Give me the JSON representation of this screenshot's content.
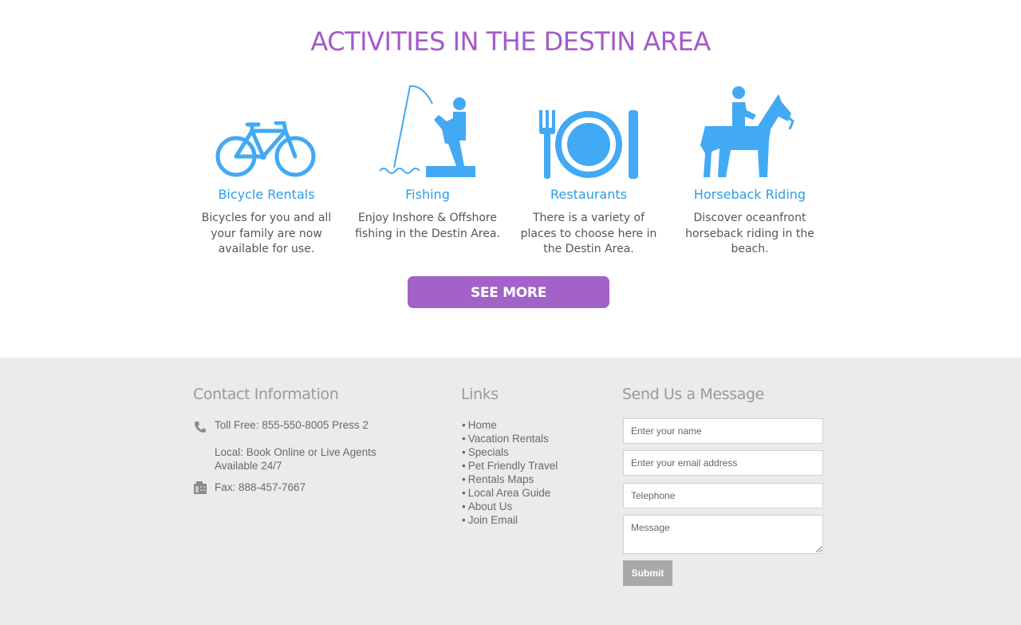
{
  "activities_section": {
    "title": "ACTIVITIES IN THE DESTIN AREA",
    "accent_color": "#a45ac8",
    "icon_color": "#42a9f5",
    "items": [
      {
        "icon": "bicycle-icon",
        "title": "Bicycle Rentals",
        "description": "Bicycles for you and all your family are now available for use."
      },
      {
        "icon": "fishing-icon",
        "title": "Fishing",
        "description": "Enjoy Inshore & Offshore fishing in the Destin Area."
      },
      {
        "icon": "restaurant-icon",
        "title": "Restaurants",
        "description": "There is a variety of places to choose here in the Destin Area."
      },
      {
        "icon": "horseback-icon",
        "title": "Horseback Riding",
        "description": "Discover oceanfront horseback riding in the beach."
      }
    ],
    "see_more_label": "SEE MORE",
    "button_color": "#a262c8"
  },
  "footer": {
    "background": "#ebebeb",
    "contact": {
      "heading": "Contact Information",
      "toll_free": "Toll Free: 855-550-8005 Press 2",
      "local_line1": "Local: Book Online or Live Agents",
      "local_line2": "Available 24/7",
      "fax": "Fax: 888-457-7667",
      "phone_icon": "phone-icon",
      "fax_icon": "fax-icon"
    },
    "links": {
      "heading": "Links",
      "items": [
        "Home",
        "Vacation Rentals",
        "Specials",
        "Pet Friendly Travel",
        "Rentals Maps",
        "Local Area Guide",
        "About Us",
        "Join Email"
      ]
    },
    "message_form": {
      "heading": "Send Us a Message",
      "name_placeholder": "Enter your name",
      "email_placeholder": "Enter your email address",
      "telephone_placeholder": "Telephone",
      "message_placeholder": "Message",
      "submit_label": "Submit"
    }
  }
}
